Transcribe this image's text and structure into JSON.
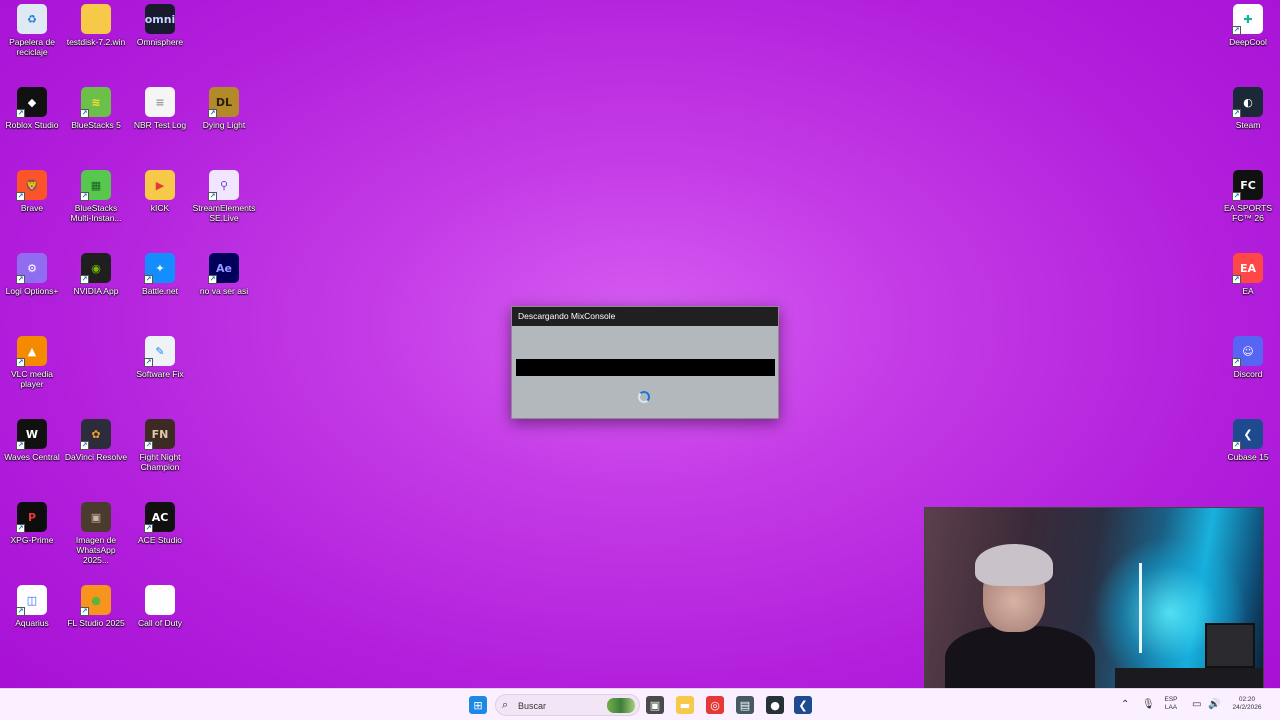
{
  "desktop": {
    "left_icons": [
      {
        "label": "Papelera de reciclaje",
        "icon": "recycle-bin-icon",
        "color": "#dfe9f3",
        "glyph": "♻",
        "glyph_color": "#1976d2",
        "shortcut": false
      },
      {
        "label": "testdisk-7.2.win",
        "icon": "folder-icon",
        "color": "#f7c948",
        "glyph": "",
        "glyph_color": "#fff",
        "shortcut": false
      },
      {
        "label": "Omnisphere",
        "icon": "omnisphere-icon",
        "color": "#1a1a2e",
        "glyph": "omni",
        "glyph_color": "#c7d3ff",
        "shortcut": false
      },
      {
        "label": "Roblox Studio",
        "icon": "roblox-studio-icon",
        "color": "#111111",
        "glyph": "◆",
        "glyph_color": "#ffffff",
        "shortcut": true
      },
      {
        "label": "BlueStacks 5",
        "icon": "bluestacks-icon",
        "color": "#6cc04a",
        "glyph": "≋",
        "glyph_color": "#ffdd33",
        "shortcut": true
      },
      {
        "label": "NBR Test Log",
        "icon": "text-file-icon",
        "color": "#f5f5f5",
        "glyph": "≡",
        "glyph_color": "#9a9a9a",
        "shortcut": false
      },
      {
        "label": "Dying Light",
        "icon": "dying-light-icon",
        "color": "#b28a2a",
        "glyph": "DL",
        "glyph_color": "#2b1d05",
        "shortcut": true
      },
      {
        "label": "Brave",
        "icon": "brave-icon",
        "color": "#fb542b",
        "glyph": "🦁",
        "glyph_color": "#fff",
        "shortcut": true
      },
      {
        "label": "BlueStacks Multi-Instan...",
        "icon": "bluestacks-multi-instance-icon",
        "color": "#57c84d",
        "glyph": "▦",
        "glyph_color": "#1b5e20",
        "shortcut": true
      },
      {
        "label": "kICK",
        "icon": "kick-folder-icon",
        "color": "#f7c948",
        "glyph": "▶",
        "glyph_color": "#e53935",
        "shortcut": false
      },
      {
        "label": "StreamElements SE.Live",
        "icon": "streamelements-icon",
        "color": "#f1e6ff",
        "glyph": "⚲",
        "glyph_color": "#7b3fe4",
        "shortcut": true
      },
      {
        "label": "Logi Options+",
        "icon": "logi-options-icon",
        "color": "#8f6cf0",
        "glyph": "⚙",
        "glyph_color": "#fff",
        "shortcut": true
      },
      {
        "label": "NVIDIA App",
        "icon": "nvidia-app-icon",
        "color": "#1f1f1f",
        "glyph": "◉",
        "glyph_color": "#76b900",
        "shortcut": true
      },
      {
        "label": "Battle.net",
        "icon": "battle-net-icon",
        "color": "#148eff",
        "glyph": "✦",
        "glyph_color": "#fff",
        "shortcut": true
      },
      {
        "label": "no va ser asi",
        "icon": "after-effects-icon",
        "color": "#00005b",
        "glyph": "Ae",
        "glyph_color": "#9999ff",
        "shortcut": true
      },
      {
        "label": "VLC media player",
        "icon": "vlc-icon",
        "color": "#f48a00",
        "glyph": "▲",
        "glyph_color": "#ffffff",
        "shortcut": true
      },
      {
        "label": "Software Fix",
        "icon": "software-fix-icon",
        "color": "#eef3f8",
        "glyph": "✎",
        "glyph_color": "#1e88e5",
        "shortcut": true
      },
      {
        "label": "Waves Central",
        "icon": "waves-central-icon",
        "color": "#111111",
        "glyph": "W",
        "glyph_color": "#ffffff",
        "shortcut": true
      },
      {
        "label": "DaVinci Resolve",
        "icon": "davinci-resolve-icon",
        "color": "#2c2c3a",
        "glyph": "✿",
        "glyph_color": "#f0a030",
        "shortcut": true
      },
      {
        "label": "Fight Night Champion",
        "icon": "fight-night-champion-icon",
        "color": "#3d2b23",
        "glyph": "FN",
        "glyph_color": "#e0c9a6",
        "shortcut": true
      },
      {
        "label": "XPG-Prime",
        "icon": "xpg-prime-icon",
        "color": "#0d0d0d",
        "glyph": "P",
        "glyph_color": "#e53935",
        "shortcut": true
      },
      {
        "label": "Imagen de WhatsApp 2025...",
        "icon": "image-file-icon",
        "color": "#4a3b2e",
        "glyph": "▣",
        "glyph_color": "#c8b89a",
        "shortcut": false
      },
      {
        "label": "ACE Studio",
        "icon": "ace-studio-icon",
        "color": "#101010",
        "glyph": "AC",
        "glyph_color": "#ffffff",
        "shortcut": true
      },
      {
        "label": "Aquarius",
        "icon": "aquarius-icon",
        "color": "#ffffff",
        "glyph": "◫",
        "glyph_color": "#2962ff",
        "shortcut": true
      },
      {
        "label": "FL Studio 2025",
        "icon": "fl-studio-icon",
        "color": "#f7941d",
        "glyph": "●",
        "glyph_color": "#5bb53d",
        "shortcut": true
      },
      {
        "label": "Call of Duty",
        "icon": "call-of-duty-file-icon",
        "color": "#ffffff",
        "glyph": "",
        "glyph_color": "#999",
        "shortcut": false
      }
    ],
    "right_icons": [
      {
        "label": "DeepCool",
        "icon": "deepcool-icon",
        "color": "#ffffff",
        "glyph": "✚",
        "glyph_color": "#10b5a0",
        "shortcut": true
      },
      {
        "label": "Steam",
        "icon": "steam-icon",
        "color": "#1b2838",
        "glyph": "◐",
        "glyph_color": "#ffffff",
        "shortcut": true
      },
      {
        "label": "EA SPORTS FC™ 26",
        "icon": "ea-sports-fc-icon",
        "color": "#111111",
        "glyph": "FC",
        "glyph_color": "#ffffff",
        "shortcut": true
      },
      {
        "label": "EA",
        "icon": "ea-icon",
        "color": "#ff4747",
        "glyph": "EA",
        "glyph_color": "#ffffff",
        "shortcut": true
      },
      {
        "label": "Discord",
        "icon": "discord-icon",
        "color": "#5865f2",
        "glyph": "☺",
        "glyph_color": "#ffffff",
        "shortcut": true
      },
      {
        "label": "Cubase 15",
        "icon": "cubase-icon",
        "color": "#1e4b8f",
        "glyph": "❮",
        "glyph_color": "#ffffff",
        "shortcut": true
      }
    ]
  },
  "dialog": {
    "title": "Descargando MixConsole",
    "titlebar_color": "#202020",
    "body_color": "#b3b8bd"
  },
  "taskbar": {
    "search_placeholder": "Buscar",
    "apps": [
      {
        "name": "start-button",
        "icon": "windows-logo-icon",
        "color": "#1e88e5",
        "glyph": "⊞"
      },
      {
        "name": "task-view-button",
        "icon": "task-view-icon",
        "color": "#4a4a4a",
        "glyph": "▣"
      },
      {
        "name": "file-explorer-button",
        "icon": "folder-icon",
        "color": "#f7c948",
        "glyph": "▬"
      },
      {
        "name": "chrome-button",
        "icon": "chrome-icon",
        "color": "#e53935",
        "glyph": "◎"
      },
      {
        "name": "app-window-button",
        "icon": "window-icon",
        "color": "#455a64",
        "glyph": "▤"
      },
      {
        "name": "recording-app-button",
        "icon": "record-app-icon",
        "color": "#263238",
        "glyph": "●"
      },
      {
        "name": "cubase-taskbar-button",
        "icon": "cubase-icon",
        "color": "#1e4b8f",
        "glyph": "❮"
      }
    ],
    "tray": {
      "language_top": "ESP",
      "language_bottom": "LAA",
      "time": "02:20",
      "date": "24/2/2026"
    }
  }
}
